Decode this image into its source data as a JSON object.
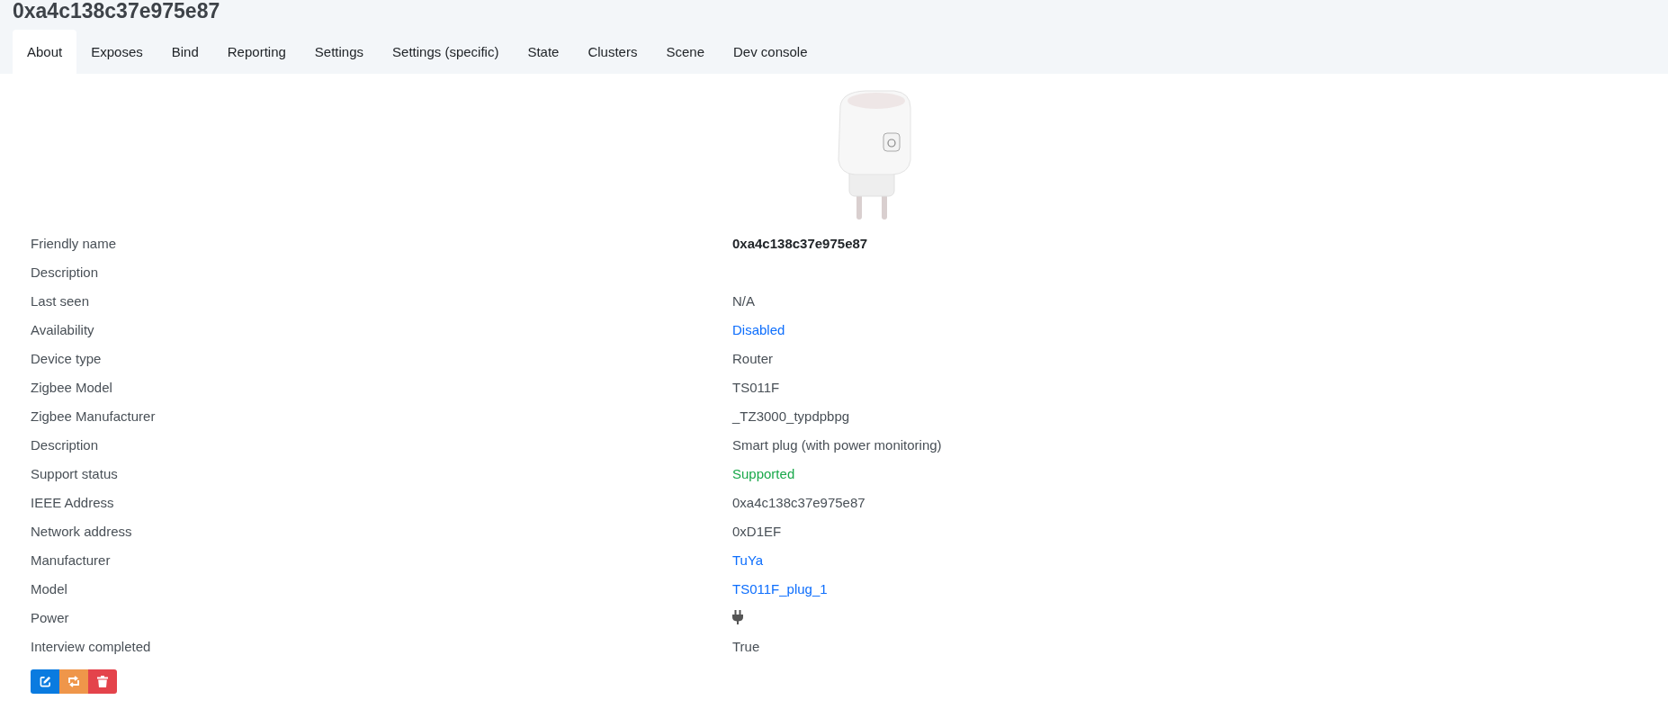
{
  "page_title": "0xa4c138c37e975e87",
  "tabs": [
    {
      "label": "About",
      "selected": true
    },
    {
      "label": "Exposes",
      "selected": false
    },
    {
      "label": "Bind",
      "selected": false
    },
    {
      "label": "Reporting",
      "selected": false
    },
    {
      "label": "Settings",
      "selected": false
    },
    {
      "label": "Settings (specific)",
      "selected": false
    },
    {
      "label": "State",
      "selected": false
    },
    {
      "label": "Clusters",
      "selected": false
    },
    {
      "label": "Scene",
      "selected": false
    },
    {
      "label": "Dev console",
      "selected": false
    }
  ],
  "details": [
    {
      "label": "Friendly name",
      "kind": "bold",
      "value": "0xa4c138c37e975e87"
    },
    {
      "label": "Description",
      "kind": "empty"
    },
    {
      "label": "Last seen",
      "kind": "text",
      "value": "N/A"
    },
    {
      "label": "Availability",
      "kind": "link",
      "value": "Disabled"
    },
    {
      "label": "Device type",
      "kind": "text",
      "value": "Router"
    },
    {
      "label": "Zigbee Model",
      "kind": "text",
      "value": "TS011F"
    },
    {
      "label": "Zigbee Manufacturer",
      "kind": "text",
      "value": "_TZ3000_typdpbpg"
    },
    {
      "label": "Description",
      "kind": "text",
      "value": "Smart plug (with power monitoring)"
    },
    {
      "label": "Support status",
      "kind": "success",
      "value": "Supported"
    },
    {
      "label": "IEEE Address",
      "kind": "text",
      "value": "0xa4c138c37e975e87"
    },
    {
      "label": "Network address",
      "kind": "text",
      "value": "0xD1EF"
    },
    {
      "label": "Manufacturer",
      "kind": "link",
      "value": "TuYa"
    },
    {
      "label": "Model",
      "kind": "link",
      "value": "TS011F_plug_1"
    },
    {
      "label": "Power",
      "kind": "icon"
    },
    {
      "label": "Interview completed",
      "kind": "text",
      "value": "True"
    }
  ],
  "actions": [
    {
      "kind": "edit"
    },
    {
      "kind": "swap"
    },
    {
      "kind": "delete"
    }
  ]
}
